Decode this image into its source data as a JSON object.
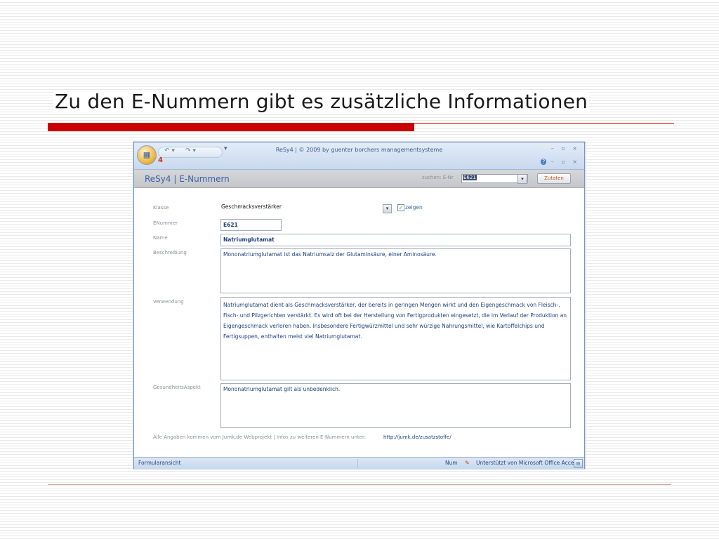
{
  "slide": {
    "title": "Zu den E-Nummern gibt es zusätzliche Informationen"
  },
  "window": {
    "title": "ReSy4 | © 2009 by guenter borchers managementsysteme",
    "ribbon_number": "4",
    "controls": "– ▫ ×",
    "help_controls": "– ▫ ×"
  },
  "form": {
    "title": "ReSy4 | E-Nummern",
    "search_label": "suchen: E-Nr",
    "search_value": "E621",
    "zutaten_button": "Zutaten",
    "fields": {
      "klasse_label": "Klasse",
      "klasse_value": "Geschmacksverstärker",
      "zeigen_label": "zeigen",
      "zeigen_checked": true,
      "enummer_label": "ENummer",
      "enummer_value": "E621",
      "name_label": "Name",
      "name_value": "Natriumglutamat",
      "beschreibung_label": "Beschreibung",
      "beschreibung_value": "Mononatriumglutamat ist das Natriumsalz der Glutaminsäure, einer Aminosäure.",
      "verwendung_label": "Verwendung",
      "verwendung_value": "Natriumglutamat dient als Geschmacksverstärker, der bereits in geringen Mengen wirkt und den Eigengeschmack von Fleisch-, Fisch- und Pilzgerichten verstärkt. Es wird oft bei der Herstellung von Fertigprodukten eingesetzt, die im Verlauf der Produktion an Eigengeschmack verloren haben. Insbesondere Fertigwürzmittel und sehr würzige Nahrungsmittel, wie Kartoffelchips und Fertigsuppen, enthalten meist viel Natriumglutamat.",
      "gesundheit_label": "GesundheitsAspekt",
      "gesundheit_value": "Mononatriumglutamat gilt als unbedenklich."
    },
    "footer_text": "Alle Angaben kommen vom Jumk.de Webprojekt | Infos zu weiteren E-Nummern unter:",
    "footer_link": "http://jumk.de/zusatzstoffe/"
  },
  "statusbar": {
    "left": "Formularansicht",
    "num": "Num",
    "powered": "Unterstützt von Microsoft Office Access"
  },
  "colors": {
    "accent_red": "#cc0000",
    "form_title_blue": "#3a64a8",
    "field_text_blue": "#1c3f7a"
  }
}
